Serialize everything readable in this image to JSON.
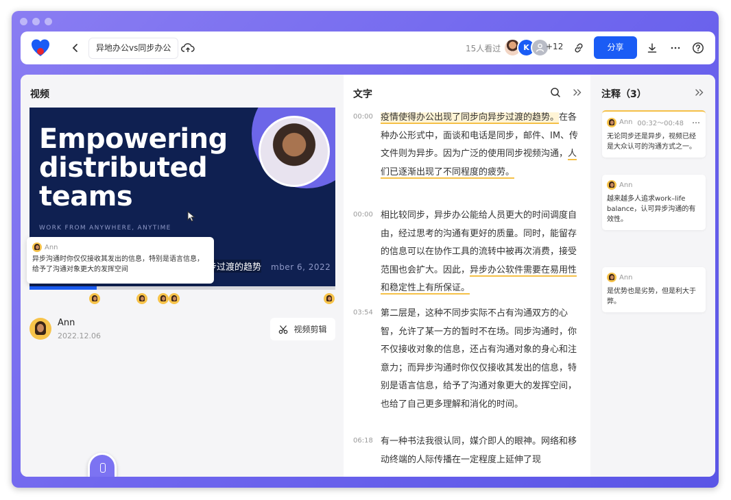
{
  "topbar": {
    "doc_title": "异地办公vs同步办公",
    "viewers": "15人看过",
    "avatar_k": "K",
    "more_count": "+12",
    "share_label": "分享"
  },
  "left": {
    "title": "视频",
    "video": {
      "headline": "Empowering\ndistributed\nteams",
      "subline": "WORK FROM ANYWHERE, ANYTIME",
      "subtitle": "步过渡的趋势",
      "date": "mber 6, 2022",
      "progress_fraction": 0.22
    },
    "tooltip": {
      "name": "Ann",
      "text": "异步沟通时你仅仅接收其发出的信息，特别是语言信息，给予了沟通对象更大的发挥空间"
    },
    "author": {
      "name": "Ann",
      "date": "2022.12.06"
    },
    "clip_label": "视频剪辑"
  },
  "middle": {
    "title": "文字",
    "segments": [
      {
        "time": "00:00",
        "parts": [
          {
            "t": "疫情使得办公出现了同步向异步过渡的趋势。",
            "s": "hl"
          },
          {
            "t": "在各种办公形式中，面谈和电话是同步，邮件、IM、传文件则为异步。因为广泛的使用同步视频沟通，",
            "s": ""
          },
          {
            "t": "人们已逐渐出现了不同程度的疲劳。",
            "s": "ul"
          }
        ]
      },
      {
        "time": "00:00",
        "parts": [
          {
            "t": "相比较同步，异步办公能给人员更大的时间调度自由，经过思考的沟通有更好的质量。同时，能留存的信息可以在协作工具的流转中被再次消费，接受范围也会扩大。因此，",
            "s": ""
          },
          {
            "t": "异步办公软件需要在易用性和稳定性上有所保证。",
            "s": "ul"
          }
        ]
      },
      {
        "time": "03:54",
        "parts": [
          {
            "t": "第二层是，这种不同步实际不占有沟通双方的心智，允许了某一方的暂时不在场。同步沟通时，你不仅接收对象的信息，还占有沟通对象的身心和注意力；而异步沟通时你仅仅接收其发出的信息，特别是语言信息，给予了沟通对象更大的发挥空间，也给了自己更多理解和消化的时间。",
            "s": ""
          }
        ]
      },
      {
        "time": "06:18",
        "parts": [
          {
            "t": "有一种书法我很认同，媒介即人的眼神。网络和移动终端的人际传播在一定程度上延伸了现",
            "s": ""
          }
        ]
      }
    ]
  },
  "right": {
    "title": "注释（3）",
    "notes": [
      {
        "name": "Ann",
        "time": "00:32～00:48",
        "text": "无论同步还是异步，视频已经是大众认可的沟通方式之一。"
      },
      {
        "name": "Ann",
        "time": "",
        "text": "越来越多人追求work–life balance，认可异步沟通的有效性。"
      },
      {
        "name": "Ann",
        "time": "",
        "text": "是优势也是劣势，但是利大于弊。"
      }
    ]
  },
  "colors": {
    "accent": "#1a5cf5",
    "highlight": "#f5c046",
    "frame": "#6f66ee",
    "video_bg": "#0f2051"
  }
}
